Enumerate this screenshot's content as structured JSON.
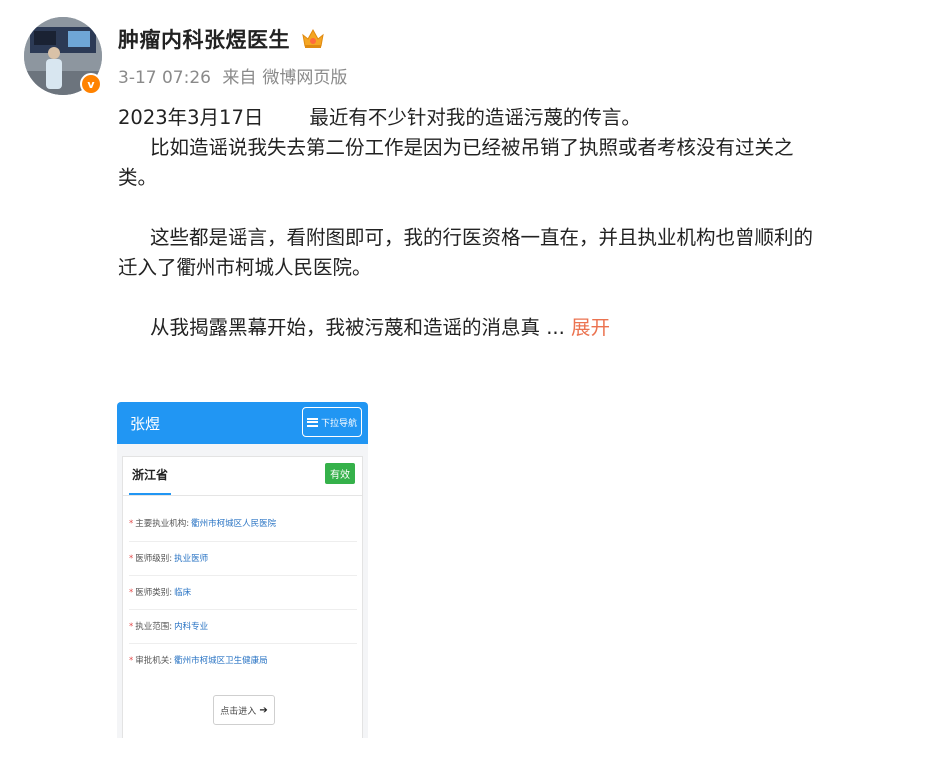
{
  "post": {
    "username": "肿瘤内科张煜医生",
    "timestamp": "3-17 07:26",
    "source_prefix": "来自",
    "source": "微博网页版",
    "verified_label": "v",
    "date": "2023年3月17日",
    "line1": "最近有不少针对我的造谣污蔑的传言。",
    "para1_indented": "比如造谣说我失去第二份工作是因为已经被吊销了执照或者考核没有过关之",
    "para1_wrap": "类。",
    "para2_line1": "这些都是谣言，看附图即可，我的行医资格一直在，并且执业机构也曾顺利的",
    "para2_line2": "迁入了衢州市柯城人民医院。",
    "para3": "从我揭露黑幕开始，我被污蔑和造谣的消息真",
    "ellipsis": "...",
    "expand_label": "展开"
  },
  "attachment": {
    "title": "张煜",
    "nav_button": "下拉导航",
    "province": "浙江省",
    "status": "有效",
    "fields": [
      {
        "label": "主要执业机构:",
        "value": "衢州市柯城区人民医院"
      },
      {
        "label": "医师级别:",
        "value": "执业医师"
      },
      {
        "label": "医师类别:",
        "value": "临床"
      },
      {
        "label": "执业范围:",
        "value": "内科专业"
      },
      {
        "label": "审批机关:",
        "value": "衢州市柯城区卫生健康局"
      }
    ],
    "enter_button": "点击进入"
  },
  "icons": {
    "verified": "verified-v-badge-icon",
    "user_tag": "crown-badge-icon",
    "menu": "hamburger-menu-icon",
    "arrow": "arrow-right-icon"
  },
  "colors": {
    "accent_link": "#eb7350",
    "verify_orange": "#ff8200",
    "topbar_blue": "#2196f3",
    "valid_green": "#35b14a"
  }
}
